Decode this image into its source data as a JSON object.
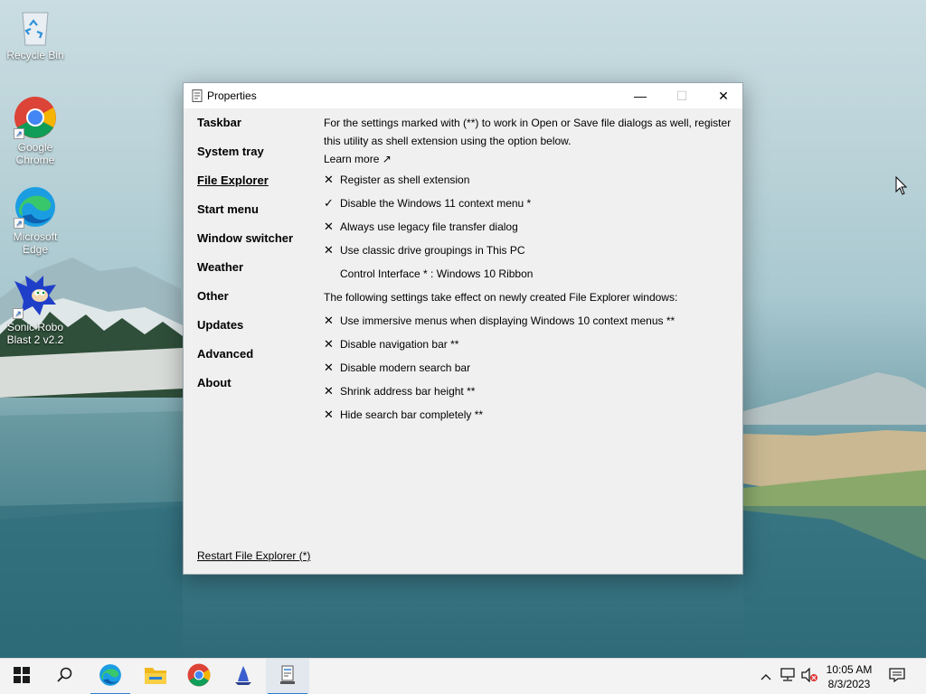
{
  "desktop": {
    "icons": [
      {
        "label": "Recycle Bin",
        "icon": "recycle-bin-icon"
      },
      {
        "label": "Google Chrome",
        "icon": "chrome-icon"
      },
      {
        "label": "Microsoft Edge",
        "icon": "edge-icon"
      },
      {
        "label": "Sonic Robo Blast 2 v2.2",
        "icon": "sonic-icon"
      }
    ]
  },
  "window": {
    "title": "Properties",
    "controls": {
      "minimize": "—",
      "maximize": "☐",
      "close": "✕"
    },
    "nav": [
      {
        "label": "Taskbar",
        "active": false
      },
      {
        "label": "System tray",
        "active": false
      },
      {
        "label": "File Explorer",
        "active": true
      },
      {
        "label": "Start menu",
        "active": false
      },
      {
        "label": "Window switcher",
        "active": false
      },
      {
        "label": "Weather",
        "active": false
      },
      {
        "label": "Other",
        "active": false
      },
      {
        "label": "Updates",
        "active": false
      },
      {
        "label": "Advanced",
        "active": false
      },
      {
        "label": "About",
        "active": false
      }
    ],
    "content": {
      "intro": "For the settings marked with (**) to work in Open or Save file dialogs as well, register this utility as shell extension using the option below.",
      "learn_more": "Learn more ↗",
      "options_a": [
        {
          "mark": "✕",
          "label": "Register as shell extension"
        },
        {
          "mark": "✓",
          "label": "Disable the Windows 11 context menu *"
        },
        {
          "mark": "✕",
          "label": "Always use legacy file transfer dialog"
        },
        {
          "mark": "✕",
          "label": "Use classic drive groupings in This PC"
        }
      ],
      "control_interface": "Control Interface * : Windows 10 Ribbon",
      "note": "The following settings take effect on newly created File Explorer windows:",
      "options_b": [
        {
          "mark": "✕",
          "label": "Use immersive menus when displaying Windows 10 context menus **"
        },
        {
          "mark": "✕",
          "label": "Disable navigation bar **"
        },
        {
          "mark": "✕",
          "label": "Disable modern search bar"
        },
        {
          "mark": "✕",
          "label": "Shrink address bar height **"
        },
        {
          "mark": "✕",
          "label": "Hide search bar completely **"
        }
      ]
    },
    "restart_link": "Restart File Explorer (*)"
  },
  "taskbar": {
    "items": [
      "start-icon",
      "search-icon",
      "edge-icon",
      "file-explorer-icon",
      "chrome-icon",
      "sailboat-app-icon",
      "properties-app-icon"
    ],
    "clock": {
      "time": "10:05 AM",
      "date": "8/3/2023"
    }
  },
  "colors": {
    "accent": "#2f7fcf",
    "window_bg": "#f0f0f0",
    "taskbar_bg": "#f3f3f3"
  }
}
